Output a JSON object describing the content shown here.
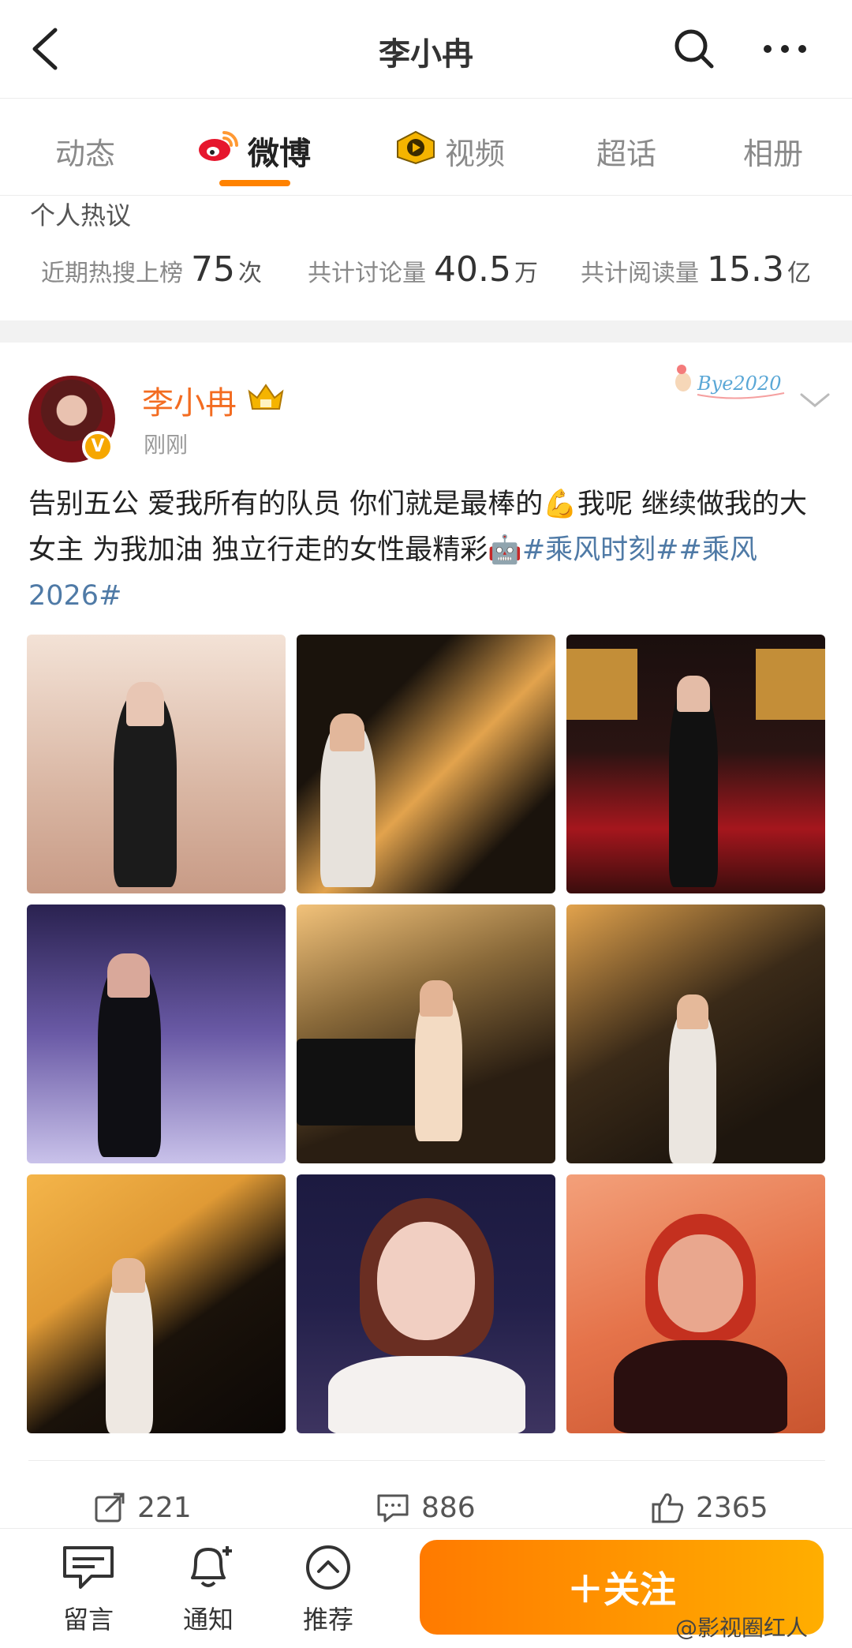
{
  "header": {
    "title": "李小冉",
    "back_icon": "back-arrow-icon",
    "search_icon": "search-icon",
    "more_icon": "more-icon"
  },
  "tabs": [
    {
      "label": "动态",
      "active": false
    },
    {
      "label": "微博",
      "active": true,
      "icon": "weibo-logo-icon"
    },
    {
      "label": "视频",
      "active": false,
      "icon": "video-play-icon"
    },
    {
      "label": "超话",
      "active": false
    },
    {
      "label": "相册",
      "active": false
    }
  ],
  "hot": {
    "title": "个人热议",
    "stats": [
      {
        "label": "近期热搜上榜",
        "value": "75",
        "unit": "次"
      },
      {
        "label": "共计讨论量",
        "value": "40.5",
        "unit": "万"
      },
      {
        "label": "共计阅读量",
        "value": "15.3",
        "unit": "亿"
      }
    ]
  },
  "post": {
    "author": "李小冉",
    "time": "刚刚",
    "badge": "Bye2020",
    "text_plain": "告别五公 爱我所有的队员 你们就是最棒的💪我呢 继续做我的大女主 为我加油 独立行走的女性最精彩🤖",
    "tag1": "#乘风时刻#",
    "tag2": "#乘风2026#",
    "photos": [
      {
        "bg": "#d9b6a3"
      },
      {
        "bg": "#1a130c"
      },
      {
        "bg": "#2a1412"
      },
      {
        "bg": "#5a4d8a"
      },
      {
        "bg": "#3b2a18"
      },
      {
        "bg": "#1e160e"
      },
      {
        "bg": "#e09a35"
      },
      {
        "bg": "#23204a"
      },
      {
        "bg": "#e5734a"
      }
    ],
    "repost_count": "221",
    "comment_count": "886",
    "like_count": "2365"
  },
  "bottom": {
    "items": [
      {
        "label": "留言",
        "icon": "message-icon"
      },
      {
        "label": "通知",
        "icon": "bell-plus-icon"
      },
      {
        "label": "推荐",
        "icon": "chevron-up-circle-icon"
      }
    ],
    "follow_label": "＋关注",
    "watermark": "@影视圈红人"
  },
  "colors": {
    "accent": "#ff8200",
    "name": "#f36c21",
    "tag": "#4f7aa6"
  }
}
